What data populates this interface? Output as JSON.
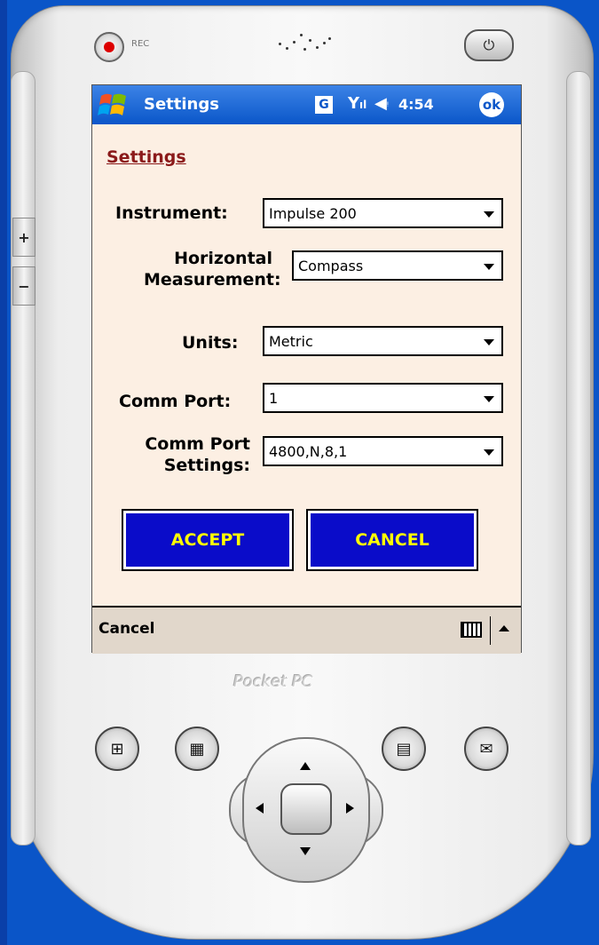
{
  "device": {
    "rec_label": "REC",
    "brand": "Pocket PC"
  },
  "titlebar": {
    "title": "Settings",
    "g_icon": "G",
    "time": "4:54",
    "ok_label": "ok"
  },
  "form": {
    "heading": "Settings",
    "instrument_label": "Instrument:",
    "instrument_value": "Impulse 200",
    "horizontal_label_1": "Horizontal",
    "horizontal_label_2": "Measurement:",
    "horizontal_value": "Compass",
    "units_label": "Units:",
    "units_value": "Metric",
    "comm_port_label": "Comm Port:",
    "comm_port_value": "1",
    "comm_settings_label_1": "Comm Port",
    "comm_settings_label_2": "Settings:",
    "comm_settings_value": "4800,N,8,1"
  },
  "buttons": {
    "accept": "ACCEPT",
    "cancel": "CANCEL"
  },
  "menubar": {
    "cancel": "Cancel"
  },
  "colors": {
    "titlebar": "#0a56c9",
    "screen_bg": "#fcefe3",
    "button_bg": "#0a0cc9",
    "button_text": "#ffff00",
    "heading": "#8b1a1a"
  }
}
